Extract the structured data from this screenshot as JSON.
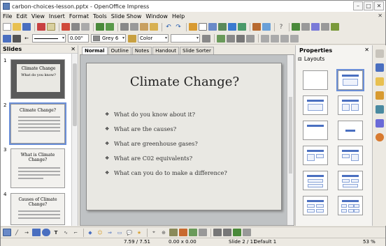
{
  "window": {
    "title": "carbon-choices-lesson.pptx - OpenOffice Impress"
  },
  "menu": [
    "File",
    "Edit",
    "View",
    "Insert",
    "Format",
    "Tools",
    "Slide Show",
    "Window",
    "Help"
  ],
  "toolbar2": {
    "line_width": "0.00\"",
    "fill_color": "Grey 6",
    "area_style": "Color"
  },
  "slides_panel": {
    "title": "Slides",
    "thumbs": [
      {
        "num": "1",
        "title": "Climate Change",
        "sub": "What do you know?"
      },
      {
        "num": "2",
        "title": "Climate Change?"
      },
      {
        "num": "3",
        "title": "What is Climate Change?"
      },
      {
        "num": "4",
        "title": "Causes of Climate Change?"
      }
    ]
  },
  "tabs": [
    "Normal",
    "Outline",
    "Notes",
    "Handout",
    "Slide Sorter"
  ],
  "slide": {
    "title": "Climate Change?",
    "bullets": [
      "What do you know about it?",
      "What are the causes?",
      "What are greenhouse gases?",
      "What are C02 equivalents?",
      "What can you do to make a difference?"
    ]
  },
  "properties": {
    "title": "Properties",
    "section": "Layouts"
  },
  "status": {
    "position": "7.59 / 7.51",
    "size": "0.00 x 0.00",
    "slide": "Slide 2 / 11",
    "master": "Default 1",
    "zoom": "53 %"
  },
  "colors": {
    "accent": "#4a6fc0",
    "selection": "#6b8fd8"
  }
}
